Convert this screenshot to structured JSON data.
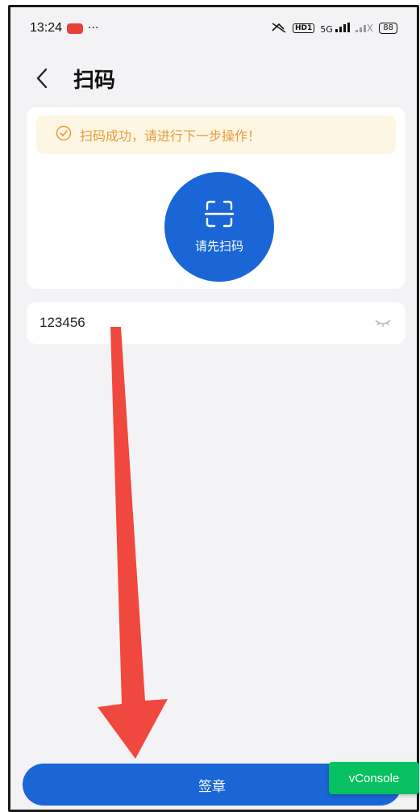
{
  "status_bar": {
    "time": "13:24",
    "more": "···",
    "network": "5G",
    "hd_badge": "HD1",
    "battery": "88"
  },
  "nav": {
    "title": "扫码",
    "back_icon": "chevron-left-icon"
  },
  "scan_card": {
    "tip_text": "扫码成功，请进行下一步操作！",
    "tip_icon": "check-circle-icon",
    "scan_button_label": "请先扫码",
    "scan_icon": "scan-frame-icon"
  },
  "password": {
    "value": "123456",
    "eye_icon": "eye-closed-icon"
  },
  "footer": {
    "sign_button_label": "签章",
    "vconsole_label": "vConsole"
  },
  "colors": {
    "primary": "#1a66d6",
    "tip_background": "#fdf6e3",
    "tip_text": "#e89a3c",
    "page_background": "#f3f3f5",
    "annotation_arrow": "#f0483e",
    "vconsole": "#07c160"
  }
}
